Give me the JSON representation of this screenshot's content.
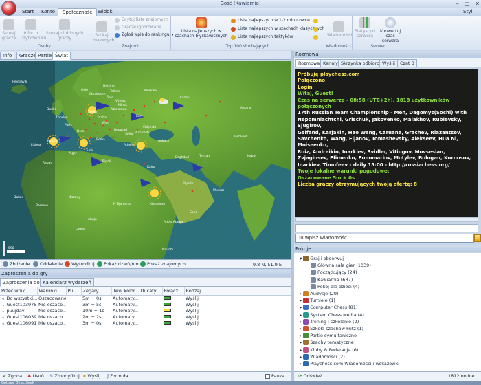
{
  "window": {
    "title": "Gość (Kawiarnia)",
    "style_label": "Styl"
  },
  "ribbon_tabs": [
    "Start",
    "Konto",
    "Społeczność",
    "Widok"
  ],
  "ribbon": {
    "osoby": {
      "label": "Osoby",
      "buttons": [
        "Szukaj gracza",
        "Infor. o użytkowniku",
        "Szukaj ulubionych graczy"
      ]
    },
    "znajomi": {
      "label": "Znajomi",
      "buttons": [
        "Szukaj znajomych"
      ],
      "lines": [
        "Edytuj listę znajomych",
        "Gracze ignorowane",
        "Zgłoś wpis do rankingu"
      ]
    },
    "top100": {
      "label": "Top 100 słuchających",
      "big": "Lista najlepszych w szachach błyskawicznych",
      "lines": [
        "Lista najlepszych w 1-2 minutowce",
        "Lista najlepszych w szachach klasycznych",
        "Lista najlepszych taktyków"
      ]
    },
    "wiadomosci": {
      "label": "Wiadomości",
      "button": "Wiadomości"
    },
    "serwer": {
      "label": "Serwer",
      "buttons": [
        "Statystyki serwera",
        "Konwertuj czas serwera"
      ]
    }
  },
  "left_tabs": [
    "Info",
    "Gracze",
    "Partie",
    "Świat"
  ],
  "map": {
    "cities": [
      "Reykjavik",
      "Oslo",
      "Helsinki",
      "Moskwa",
      "Stockholm",
      "Riga",
      "Dublin",
      "London",
      "Berlin",
      "Kiev",
      "Paris",
      "Wien",
      "Madrid",
      "Roma",
      "Ankara",
      "Lisboa",
      "Alger",
      "Tunis",
      "Tripoli",
      "Kairo",
      "Baghdad",
      "Tehran",
      "Riyadh",
      "Rabat",
      "Astana",
      "Tashkent",
      "Kabul",
      "Khartoum",
      "Addis Abeba",
      "Nairobi",
      "Bamako",
      "Dakar",
      "Lagos",
      "Niamey",
      "Abuja",
      "N'Djamena",
      "Sana",
      "Muscat",
      "Kazan",
      "Minsk",
      "Chișinău",
      "Sofia",
      "Athens",
      "Bucuresti",
      "Beograd",
      "Warszawa",
      "Praha",
      "Bern",
      "Vilnius",
      "Tallinn"
    ],
    "zoom_readout": "598"
  },
  "map_toolbar": {
    "zoom_in": "Zbliżenie",
    "zoom_out": "Oddalenie",
    "center": "Wyśrodkuj",
    "daynight": "Pokaż dzień/noc",
    "friends": "Pokaż znajomych",
    "coords": "9.8 N, 51.9 E"
  },
  "seek": {
    "title": "Zaproszenia do gry",
    "tabs": [
      "Zaproszenia do gry",
      "Kalendarz wydarzeń"
    ],
    "columns": [
      "Przeciwnik",
      "Warunki",
      "Pu...",
      "Zegary",
      "Twój kolor",
      "Ducaty",
      "Połącz...",
      "Rodzaj"
    ],
    "rows": [
      {
        "opponent": "Do wszystki...",
        "cond": "Oszacowane",
        "pu": "",
        "clock": "5m + 0s",
        "color": "Automaty...",
        "ducats": "",
        "conn": "#39a83c",
        "kind": "Wyślij"
      },
      {
        "opponent": "Guest103975",
        "cond": "Nie oszaco...",
        "pu": "",
        "clock": "3m + 5s",
        "color": "Automaty...",
        "ducats": "",
        "conn": "#39a83c",
        "kind": "Wyślij"
      },
      {
        "opponent": "puujdav",
        "cond": "Nie oszaco...",
        "pu": "",
        "clock": "10m + 1s",
        "color": "Automaty...",
        "ducats": "",
        "conn": "#f2e63a",
        "kind": "Wyślij"
      },
      {
        "opponent": "Guest106039",
        "cond": "Nie oszaco...",
        "pu": "",
        "clock": "2m + 2s",
        "color": "Automaty...",
        "ducats": "",
        "conn": "#39a83c",
        "kind": "Wyślij"
      },
      {
        "opponent": "Guest106091",
        "cond": "Nie oszaco...",
        "pu": "",
        "clock": "3m + 0s",
        "color": "Automaty...",
        "ducats": "",
        "conn": "#39a83c",
        "kind": "Wyślij"
      }
    ]
  },
  "seek_bar": {
    "accept": "Zgoda",
    "remove": "Usuń",
    "modify": "Zmodyfikuj",
    "send": "Wyślij",
    "formula": "Formuła",
    "pause": "Pauza"
  },
  "status": "Gotowe   DirectSeek",
  "chat": {
    "title": "Rozmowa",
    "tabs": [
      "Rozmowa",
      "Kanały",
      "Skrzynka odbiorcza",
      "Wyślij",
      "Czat B"
    ],
    "lines": [
      {
        "c": "y",
        "t": "Próbuję playchess.com"
      },
      {
        "c": "y",
        "t": "Połączono"
      },
      {
        "c": "y",
        "t": "Login"
      },
      {
        "c": "g",
        "t": "Witaj, Guest!"
      },
      {
        "c": "g",
        "t": "Czas na serwerze - 08:58 (UTC+2h), 1818 użytkowników połączonych"
      },
      {
        "c": "w",
        "t": "17th Russian Team Championship - Men, Dagomys(Sochi) with"
      },
      {
        "c": "w",
        "t": "Nepomniachtchi, Grischuk, Jakovenko, Malakhov, Rublevsky, Sjugirov,"
      },
      {
        "c": "w",
        "t": "Gelfand, Karjakin, Hao Wang, Caruana, Grachev, Riazantsev,"
      },
      {
        "c": "w",
        "t": "Savchenko, Wang, Eljanov, Tomashevsky, Alekseev, Hua Ni, Moiseenko,"
      },
      {
        "c": "w",
        "t": "Roiz, Andreikin, Inarkiev, Svidler, Vitiugov, Movsesian,"
      },
      {
        "c": "w",
        "t": "Zvjaginsev, Efimenko, Ponomariov, Motylev, Bologan, Kurnosov,"
      },
      {
        "c": "w",
        "t": "Inarkiev, Timofeev - daily 13:00 - http://russiachess.org/"
      },
      {
        "c": "g",
        "t": "Twoje lokalne warunki pogodowe:"
      },
      {
        "c": "g",
        "t": "Oszacowane 5m + 0s"
      },
      {
        "c": "y",
        "t": "Liczba graczy otrzymujących twoją ofertę: 8"
      }
    ],
    "input_placeholder": "Tu wpisz wiadomość"
  },
  "rooms": {
    "title": "Pokoje",
    "items": [
      {
        "level": 0,
        "label": "Graj i obserwuj",
        "icon": "chess-piece"
      },
      {
        "level": 1,
        "label": "Główna sala gier  (1039)",
        "icon": "room"
      },
      {
        "level": 1,
        "label": "Początkujący  (24)",
        "icon": "room"
      },
      {
        "level": 1,
        "label": "Kawiarnia  (637)",
        "icon": "room"
      },
      {
        "level": 1,
        "label": "Pokój dla dzieci  (4)",
        "icon": "room"
      },
      {
        "level": 0,
        "label": "Audycje  (29)",
        "icon": "broadcast"
      },
      {
        "level": 0,
        "label": "Turnieje  (1)",
        "icon": "tournament"
      },
      {
        "level": 0,
        "label": "Computer Chess  (81)",
        "icon": "computer"
      },
      {
        "level": 0,
        "label": "System Chess Media  (4)",
        "icon": "media"
      },
      {
        "level": 0,
        "label": "Trening i szkolenie  (2)",
        "icon": "training"
      },
      {
        "level": 0,
        "label": "Szkoła szachów Fritz  (1)",
        "icon": "school"
      },
      {
        "level": 0,
        "label": "Partie symultaniczne",
        "icon": "simul"
      },
      {
        "level": 0,
        "label": "Szachy tematyczne",
        "icon": "theme"
      },
      {
        "level": 0,
        "label": "Kluby & Federacje  (6)",
        "icon": "club"
      },
      {
        "level": 0,
        "label": "Wiadomości  (2)",
        "icon": "news"
      },
      {
        "level": 0,
        "label": "Playchess.com Wiadomości i wskazówki",
        "icon": "tips"
      }
    ],
    "refresh": "Odśwież",
    "online": "1812 online"
  }
}
